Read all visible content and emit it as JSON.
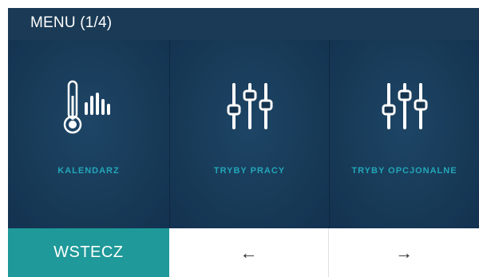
{
  "header": {
    "title": "MENU (1/4)"
  },
  "tiles": [
    {
      "label": "KALENDARZ",
      "icon": "thermometer-chart-icon"
    },
    {
      "label": "TRYBY PRACY",
      "icon": "sliders-icon"
    },
    {
      "label": "TRYBY OPCJONALNE",
      "icon": "sliders-icon"
    }
  ],
  "footer": {
    "back_label": "WSTECZ",
    "prev_icon": "arrow-left-icon",
    "prev_glyph": "←",
    "next_icon": "arrow-right-icon",
    "next_glyph": "→"
  },
  "colors": {
    "panel_background": "#16344e",
    "tile_label": "#23a6b8",
    "back_button": "#1f9999"
  }
}
